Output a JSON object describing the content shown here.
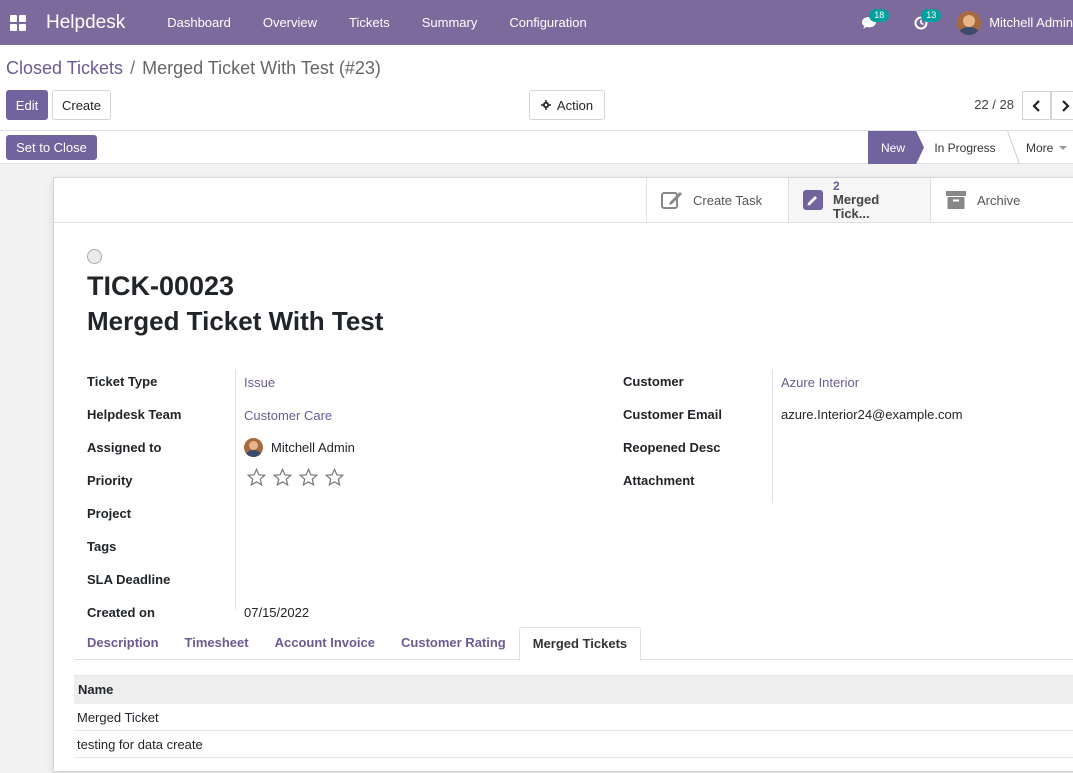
{
  "navbar": {
    "brand": "Helpdesk",
    "menu": [
      "Dashboard",
      "Overview",
      "Tickets",
      "Summary",
      "Configuration"
    ],
    "messages_count": "18",
    "activities_count": "13",
    "user_name": "Mitchell Admin"
  },
  "breadcrumb": {
    "parent": "Closed Tickets",
    "separator": "/",
    "current": "Merged Ticket With Test (#23)"
  },
  "toolbar": {
    "edit_label": "Edit",
    "create_label": "Create",
    "action_label": "Action"
  },
  "pager": {
    "value": "22 / 28"
  },
  "statusbar": {
    "set_to_close_label": "Set to Close",
    "stages": [
      "New",
      "In Progress"
    ],
    "active_stage": "New",
    "more_label": "More"
  },
  "smart_buttons": {
    "create_task_label": "Create Task",
    "merged_count": "2",
    "merged_label": "Merged Tick...",
    "archive_label": "Archive"
  },
  "ticket": {
    "reference": "TICK-00023",
    "name": "Merged Ticket With Test"
  },
  "fields_left": {
    "ticket_type": {
      "label": "Ticket Type",
      "value": "Issue"
    },
    "helpdesk_team": {
      "label": "Helpdesk Team",
      "value": "Customer Care"
    },
    "assigned_to": {
      "label": "Assigned to",
      "value": "Mitchell Admin"
    },
    "priority": {
      "label": "Priority",
      "stars": 0,
      "max_stars": 4
    },
    "project": {
      "label": "Project",
      "value": ""
    },
    "tags": {
      "label": "Tags",
      "value": ""
    },
    "sla_deadline": {
      "label": "SLA Deadline",
      "value": ""
    },
    "created_on": {
      "label": "Created on",
      "value": "07/15/2022"
    }
  },
  "fields_right": {
    "customer": {
      "label": "Customer",
      "value": "Azure Interior"
    },
    "customer_email": {
      "label": "Customer Email",
      "value": "azure.Interior24@example.com"
    },
    "reopened_desc": {
      "label": "Reopened Desc",
      "value": ""
    },
    "attachment": {
      "label": "Attachment",
      "value": ""
    }
  },
  "tabs": [
    "Description",
    "Timesheet",
    "Account Invoice",
    "Customer Rating",
    "Merged Tickets"
  ],
  "active_tab": "Merged Tickets",
  "merged_list": {
    "header": "Name",
    "rows": [
      "Merged Ticket",
      "testing for data create"
    ]
  }
}
